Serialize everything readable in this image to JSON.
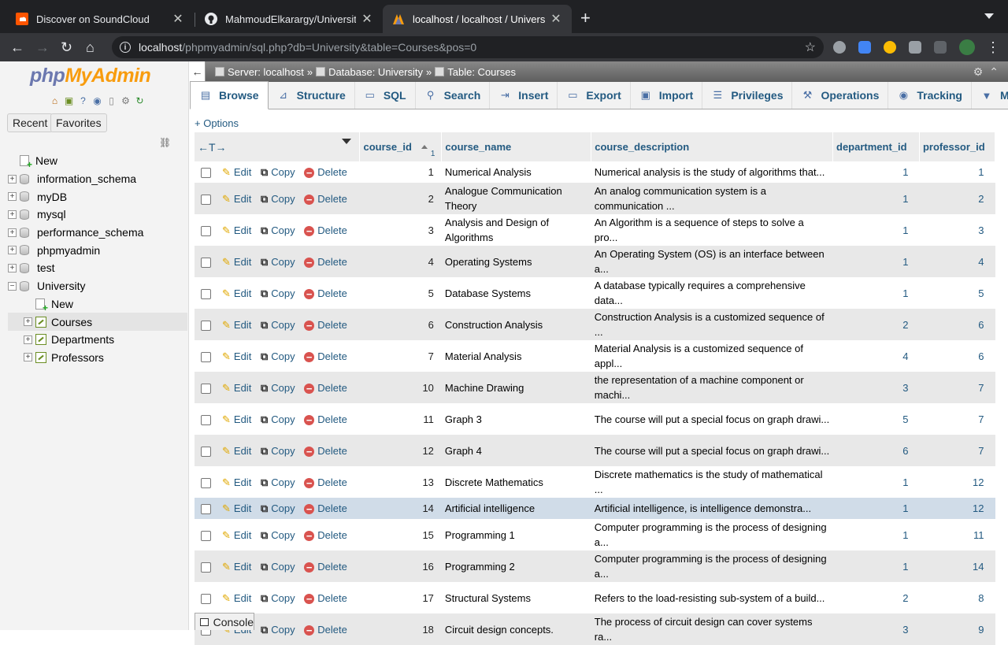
{
  "browser": {
    "tabs": [
      {
        "title": "Discover on SoundCloud",
        "icon": "soundcloud-icon",
        "active": false
      },
      {
        "title": "MahmoudElkarargy/University-",
        "icon": "github-icon",
        "active": false
      },
      {
        "title": "localhost / localhost / Universit",
        "icon": "phpmyadmin-icon",
        "active": true
      }
    ],
    "new_tab": "+",
    "url_host": "localhost",
    "url_path": "/phpmyadmin/sql.php?db=University&table=Courses&pos=0"
  },
  "sidebar": {
    "logo_php": "php",
    "logo_myadmin": "MyAdmin",
    "recent_label": "Recent",
    "favorites_label": "Favorites",
    "tree": [
      {
        "label": "New",
        "type": "new",
        "level": 0
      },
      {
        "label": "information_schema",
        "type": "db",
        "level": 0
      },
      {
        "label": "myDB",
        "type": "db",
        "level": 0
      },
      {
        "label": "mysql",
        "type": "db",
        "level": 0
      },
      {
        "label": "performance_schema",
        "type": "db",
        "level": 0
      },
      {
        "label": "phpmyadmin",
        "type": "db",
        "level": 0
      },
      {
        "label": "test",
        "type": "db",
        "level": 0
      },
      {
        "label": "University",
        "type": "db-open",
        "level": 0
      },
      {
        "label": "New",
        "type": "new",
        "level": 1
      },
      {
        "label": "Courses",
        "type": "table",
        "level": 1,
        "selected": true
      },
      {
        "label": "Departments",
        "type": "table",
        "level": 1
      },
      {
        "label": "Professors",
        "type": "table",
        "level": 1
      }
    ]
  },
  "breadcrumb": {
    "server": "Server: localhost",
    "database": "Database: University",
    "table": "Table: Courses",
    "sep": "»"
  },
  "tabs": [
    {
      "label": "Browse",
      "icon": "browse-icon",
      "active": true
    },
    {
      "label": "Structure",
      "icon": "structure-icon"
    },
    {
      "label": "SQL",
      "icon": "sql-icon"
    },
    {
      "label": "Search",
      "icon": "search-icon"
    },
    {
      "label": "Insert",
      "icon": "insert-icon"
    },
    {
      "label": "Export",
      "icon": "export-icon"
    },
    {
      "label": "Import",
      "icon": "import-icon"
    },
    {
      "label": "Privileges",
      "icon": "privileges-icon"
    },
    {
      "label": "Operations",
      "icon": "operations-icon"
    },
    {
      "label": "Tracking",
      "icon": "tracking-icon"
    },
    {
      "label": "More",
      "icon": "chevron-down-icon"
    }
  ],
  "options_label": "+ Options",
  "grid": {
    "columns": [
      "course_id",
      "course_name",
      "course_description",
      "department_id",
      "professor_id"
    ],
    "sort_index": "1",
    "actions": {
      "edit": "Edit",
      "copy": "Copy",
      "delete": "Delete"
    },
    "rows": [
      {
        "id": "1",
        "name": "Numerical Analysis",
        "desc": "Numerical analysis is the study of algorithms that...",
        "dept": "1",
        "prof": "1"
      },
      {
        "id": "2",
        "name": "Analogue Communication Theory",
        "desc": "An analog communication system is a communication ...",
        "dept": "1",
        "prof": "2"
      },
      {
        "id": "3",
        "name": "Analysis and Design of Algorithms",
        "desc": "An Algorithm is a sequence of steps to solve a pro...",
        "dept": "1",
        "prof": "3"
      },
      {
        "id": "4",
        "name": "Operating Systems",
        "desc": "An Operating System (OS) is an interface between a...",
        "dept": "1",
        "prof": "4"
      },
      {
        "id": "5",
        "name": "Database Systems",
        "desc": "A database typically requires a comprehensive data...",
        "dept": "1",
        "prof": "5"
      },
      {
        "id": "6",
        "name": "Construction Analysis",
        "desc": "Construction Analysis is a customized sequence of ...",
        "dept": "2",
        "prof": "6"
      },
      {
        "id": "7",
        "name": "Material Analysis",
        "desc": "Material Analysis is a customized sequence of appl...",
        "dept": "4",
        "prof": "6"
      },
      {
        "id": "10",
        "name": "Machine Drawing",
        "desc": "the representation of a machine component or machi...",
        "dept": "3",
        "prof": "7"
      },
      {
        "id": "11",
        "name": "Graph 3",
        "desc": "The course will put a special focus on graph drawi...",
        "dept": "5",
        "prof": "7"
      },
      {
        "id": "12",
        "name": "Graph 4",
        "desc": "The course will put a special focus on graph drawi...",
        "dept": "6",
        "prof": "7"
      },
      {
        "id": "13",
        "name": "Discrete Mathematics",
        "desc": "Discrete mathematics is the study of mathematical ...",
        "dept": "1",
        "prof": "12"
      },
      {
        "id": "14",
        "name": "Artificial intelligence",
        "desc": "Artificial intelligence, is intelligence demonstra...",
        "dept": "1",
        "prof": "12",
        "highlight": true
      },
      {
        "id": "15",
        "name": "Programming 1",
        "desc": "Computer programming is the process of designing a...",
        "dept": "1",
        "prof": "11"
      },
      {
        "id": "16",
        "name": "Programming 2",
        "desc": "Computer programming is the process of designing a...",
        "dept": "1",
        "prof": "14"
      },
      {
        "id": "17",
        "name": "Structural Systems",
        "desc": "Refers to the load-resisting sub-system of a build...",
        "dept": "2",
        "prof": "8"
      },
      {
        "id": "18",
        "name": "Circuit design concepts.",
        "desc": "The process of circuit design can cover systems ra...",
        "dept": "3",
        "prof": "9"
      }
    ]
  },
  "console_label": "Console"
}
